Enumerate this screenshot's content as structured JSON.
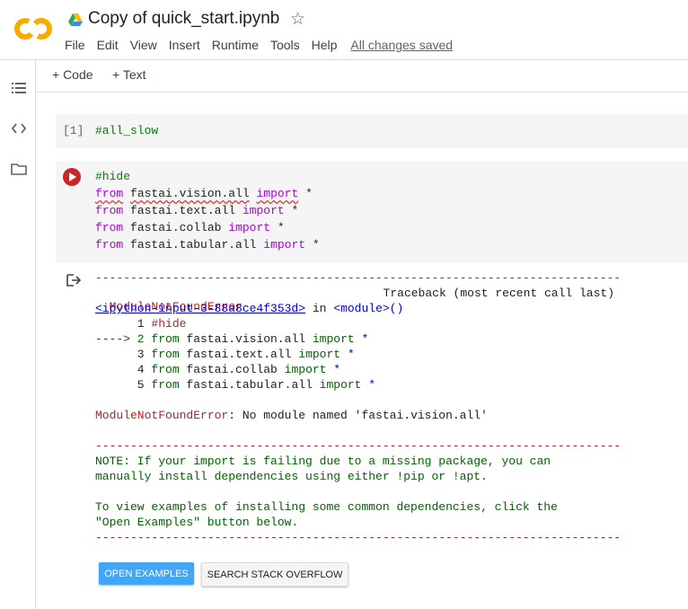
{
  "header": {
    "title": "Copy of quick_start.ipynb",
    "star_icon": "star-outline-icon",
    "logo_icon": "colab-logo",
    "drive_icon": "google-drive-icon"
  },
  "menu": {
    "items": [
      "File",
      "Edit",
      "View",
      "Insert",
      "Runtime",
      "Tools",
      "Help"
    ],
    "saved_status": "All changes saved"
  },
  "toolbar": {
    "add_code": "+ Code",
    "add_text": "+ Text"
  },
  "sidebar": {
    "icons": [
      "table-of-contents-icon",
      "code-snippets-icon",
      "files-folder-icon"
    ]
  },
  "cells": [
    {
      "exec_count": "[1]",
      "code": "#all_slow"
    },
    {
      "lines": [
        {
          "comment": "#hide"
        },
        {
          "from": "from",
          "module": "fastai.vision.all",
          "import": "import",
          "star": "*"
        },
        {
          "from": "from",
          "module": "fastai.text.all",
          "import": "import",
          "star": "*"
        },
        {
          "from": "from",
          "module": "fastai.collab",
          "import": "import",
          "star": "*"
        },
        {
          "from": "from",
          "module": "fastai.tabular.all",
          "import": "import",
          "star": "*"
        }
      ]
    }
  ],
  "output": {
    "separator": "---------------------------------------------------------------------------",
    "error_name": "ModuleNotFoundError",
    "traceback_label": "Traceback (most recent call last)",
    "input_link": "<ipython-input-3-88a8ce4f353d>",
    "in_text": " in ",
    "module_link": "<module>()",
    "trace_lines": [
      {
        "prefix": "      1 ",
        "comment": "#hide"
      },
      {
        "prefix": "----> 2 ",
        "from": "from",
        "module": " fastai.vision.all ",
        "import": "import",
        "star": " *"
      },
      {
        "prefix": "      3 ",
        "from": "from",
        "module": " fastai.text.all ",
        "import": "import",
        "star": " *"
      },
      {
        "prefix": "      4 ",
        "from": "from",
        "module": " fastai.collab ",
        "import": "import",
        "star": " *"
      },
      {
        "prefix": "      5 ",
        "from": "from",
        "module": " fastai.tabular.all ",
        "import": "import",
        "star": " *"
      }
    ],
    "error_message": ": No module named 'fastai.vision.all'",
    "note_lines": [
      "NOTE: If your import is failing due to a missing package, you can",
      "manually install dependencies using either !pip or !apt."
    ],
    "example_lines": [
      "To view examples of installing some common dependencies, click the",
      "\"Open Examples\" button below."
    ],
    "buttons": {
      "open_examples": "OPEN EXAMPLES",
      "search_stack_overflow": "SEARCH STACK OVERFLOW"
    }
  }
}
